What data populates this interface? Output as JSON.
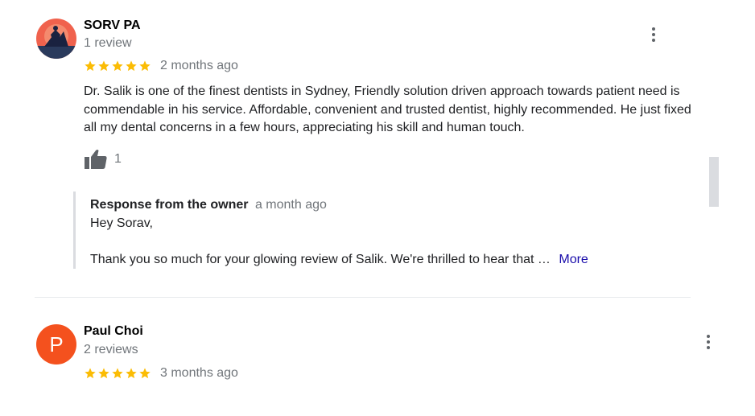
{
  "reviews": [
    {
      "author": "SORV PA",
      "review_count": "1 review",
      "stars": 5,
      "date": "2 months ago",
      "text": "Dr. Salik is one of the finest dentists in Sydney, Friendly solution driven approach towards patient need is commendable in his service. Affordable, convenient and trusted dentist, highly recommended. He just fixed all my dental concerns in a few hours, appreciating his skill and human touch.",
      "likes": "1",
      "owner_response": {
        "label": "Response from the owner",
        "ago": "a month ago",
        "greeting": "Hey Sorav,",
        "text": "Thank you so much for your glowing review of Salik. We're thrilled to hear that …",
        "more": "More"
      }
    },
    {
      "author": "Paul Choi",
      "avatar_letter": "P",
      "review_count": "2 reviews",
      "stars": 5,
      "date": "3 months ago"
    }
  ],
  "colors": {
    "star": "#fbbc04",
    "avatar_p": "#f4511e",
    "link": "#1a0dab",
    "muted": "#70757a"
  },
  "icons": {
    "star": "star-icon",
    "thumb": "thumbs-up-icon",
    "menu": "more-vert-icon"
  }
}
